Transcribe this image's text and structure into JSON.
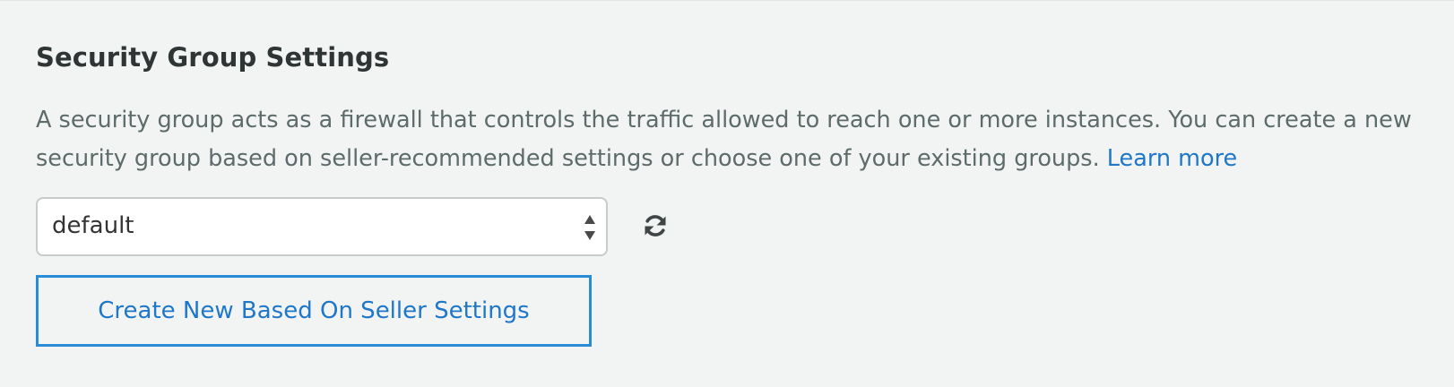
{
  "section": {
    "title": "Security Group Settings",
    "description": "A security group acts as a firewall that controls the traffic allowed to reach one or more instances. You can create a new security group based on seller-recommended settings or choose one of your existing groups.",
    "learn_more_link": "Learn more"
  },
  "security_group_select": {
    "selected_value": "default"
  },
  "actions": {
    "refresh_icon": "refresh-icon",
    "create_button_label": "Create New Based On Seller Settings"
  },
  "colors": {
    "background": "#f2f3f3",
    "link": "#1f77c7",
    "button_border": "#2a8bd6",
    "title": "#2f3434",
    "body_text": "#5e6b6b"
  }
}
